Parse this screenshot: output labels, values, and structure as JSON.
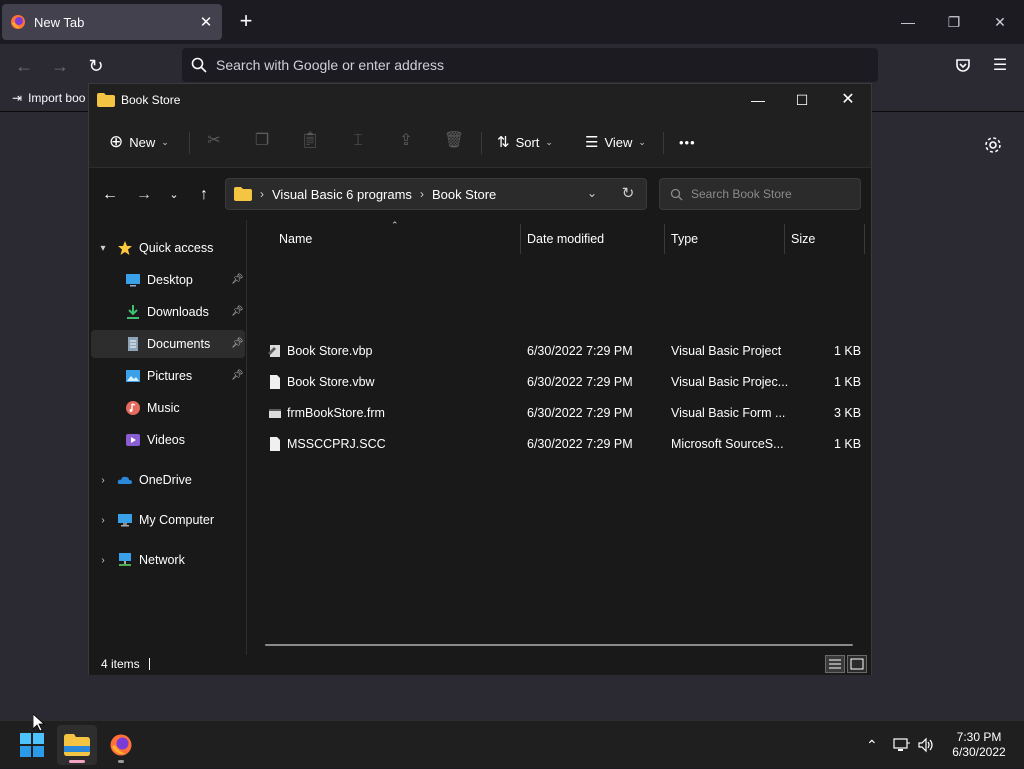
{
  "browser": {
    "tab_title": "New Tab",
    "tab_close": "✕",
    "new_tab": "+",
    "url_placeholder": "Search with Google or enter address",
    "bookmark_item": "Import boo"
  },
  "explorer": {
    "window_title": "Book Store",
    "toolbar": {
      "new_label": "New",
      "sort_label": "Sort",
      "view_label": "View",
      "more_label": "•••"
    },
    "breadcrumb": [
      "Visual Basic 6 programs",
      "Book Store"
    ],
    "search_placeholder": "Search Book Store",
    "nav": {
      "quick_access": "Quick access",
      "desktop": "Desktop",
      "downloads": "Downloads",
      "documents": "Documents",
      "pictures": "Pictures",
      "music": "Music",
      "videos": "Videos",
      "onedrive": "OneDrive",
      "my_computer": "My Computer",
      "network": "Network"
    },
    "columns": {
      "name": "Name",
      "date": "Date modified",
      "type": "Type",
      "size": "Size"
    },
    "files": [
      {
        "name": "Book Store.vbp",
        "date": "6/30/2022 7:29 PM",
        "type": "Visual Basic Project",
        "size": "1 KB",
        "icon": "vbp-file-icon"
      },
      {
        "name": "Book Store.vbw",
        "date": "6/30/2022 7:29 PM",
        "type": "Visual Basic Projec...",
        "size": "1 KB",
        "icon": "document-icon"
      },
      {
        "name": "frmBookStore.frm",
        "date": "6/30/2022 7:29 PM",
        "type": "Visual Basic Form ...",
        "size": "3 KB",
        "icon": "vb-form-icon"
      },
      {
        "name": "MSSCCPRJ.SCC",
        "date": "6/30/2022 7:29 PM",
        "type": "Microsoft SourceS...",
        "size": "1 KB",
        "icon": "document-icon"
      }
    ],
    "status_count": "4 items"
  },
  "taskbar": {
    "time": "7:30 PM",
    "date": "6/30/2022"
  },
  "colors": {
    "accent": "#0078d4",
    "folder": "#f4c542",
    "star": "#ffc83d",
    "explorer_indicator": "#f3a3c3"
  }
}
